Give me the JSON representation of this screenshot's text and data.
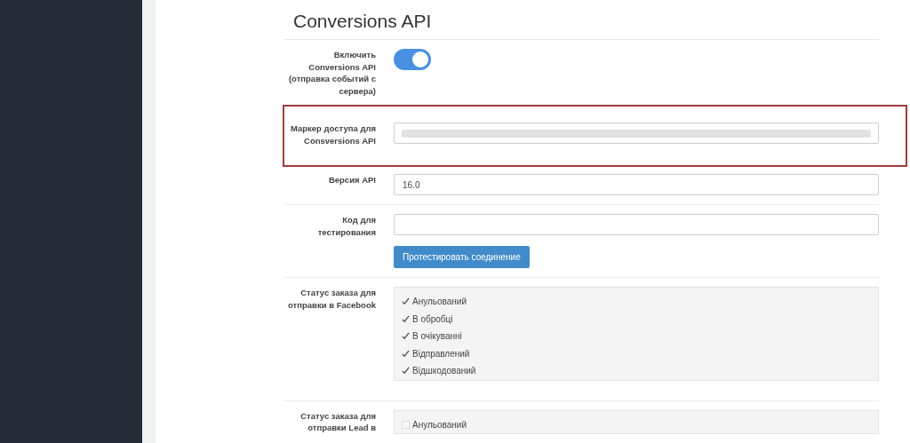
{
  "title": "Conversions API",
  "rows": [
    {
      "kind": "toggle",
      "label": "Включить Conversions API (отправка событий с сервера)",
      "on": true,
      "highlighted": false
    },
    {
      "kind": "secret",
      "label": "Маркер доступа для Consversions API",
      "highlighted": true
    },
    {
      "kind": "text",
      "label": "Версия API",
      "value": "16.0",
      "highlighted": false
    },
    {
      "kind": "text_button",
      "label": "Код для тестирования",
      "value": "",
      "button": "Протестировать соединение",
      "highlighted": false
    },
    {
      "kind": "checklist",
      "label": "Статус заказа для отправки в Facebook",
      "highlighted": false,
      "items": [
        {
          "label": "Анульований",
          "checked": true
        },
        {
          "label": "В обробці",
          "checked": true
        },
        {
          "label": "В очікуванні",
          "checked": true
        },
        {
          "label": "Відправлений",
          "checked": true
        },
        {
          "label": "Відшкодований",
          "checked": true
        }
      ]
    },
    {
      "kind": "checklist",
      "label": "Статус заказа для отправки Lead в",
      "highlighted": false,
      "items": [
        {
          "label": "Анульований",
          "checked": false
        }
      ]
    }
  ]
}
